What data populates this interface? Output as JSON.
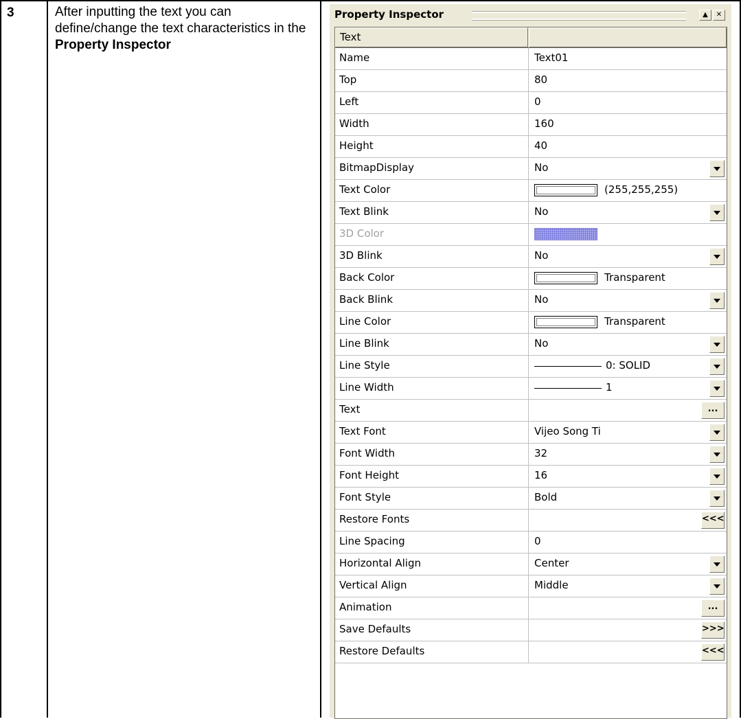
{
  "step": {
    "number": "3",
    "text_before": "After inputting the text you can define/change the text characteristics in the ",
    "text_bold": "Property Inspector"
  },
  "inspector": {
    "title": "Property Inspector",
    "title_buttons": [
      "▲",
      "✕"
    ],
    "header": {
      "name_col": "Text",
      "value_col": ""
    },
    "rows": [
      {
        "name": "Name",
        "value": "Text01",
        "kind": "text"
      },
      {
        "name": "Top",
        "value": "80",
        "kind": "text"
      },
      {
        "name": "Left",
        "value": "0",
        "kind": "text"
      },
      {
        "name": "Width",
        "value": "160",
        "kind": "text"
      },
      {
        "name": "Height",
        "value": "40",
        "kind": "text"
      },
      {
        "name": "BitmapDisplay",
        "value": "No",
        "kind": "dropdown"
      },
      {
        "name": "Text Color",
        "value": "(255,255,255)",
        "kind": "color",
        "swatch": "#ffffff"
      },
      {
        "name": "Text Blink",
        "value": "No",
        "kind": "dropdown"
      },
      {
        "name": "3D Color",
        "value": "",
        "kind": "color-pattern",
        "disabled": true
      },
      {
        "name": "3D Blink",
        "value": "No",
        "kind": "dropdown"
      },
      {
        "name": "Back Color",
        "value": "Transparent",
        "kind": "color",
        "swatch": "#ffffff"
      },
      {
        "name": "Back Blink",
        "value": "No",
        "kind": "dropdown"
      },
      {
        "name": "Line Color",
        "value": "Transparent",
        "kind": "color",
        "swatch": "#ffffff"
      },
      {
        "name": "Line Blink",
        "value": "No",
        "kind": "dropdown"
      },
      {
        "name": "Line Style",
        "value": "0: SOLID",
        "kind": "line-dropdown"
      },
      {
        "name": "Line Width",
        "value": "1",
        "kind": "line-dropdown"
      },
      {
        "name": "Text",
        "value": "",
        "kind": "button",
        "button_label": "..."
      },
      {
        "name": "Text Font",
        "value": "Vijeo Song Ti",
        "kind": "dropdown"
      },
      {
        "name": "Font Width",
        "value": "32",
        "kind": "dropdown"
      },
      {
        "name": "Font Height",
        "value": "16",
        "kind": "dropdown"
      },
      {
        "name": "Font Style",
        "value": "Bold",
        "kind": "dropdown"
      },
      {
        "name": "Restore Fonts",
        "value": "",
        "kind": "button",
        "button_label": "<<<"
      },
      {
        "name": "Line Spacing",
        "value": "0",
        "kind": "text"
      },
      {
        "name": "Horizontal Align",
        "value": "Center",
        "kind": "dropdown"
      },
      {
        "name": "Vertical Align",
        "value": "Middle",
        "kind": "dropdown"
      },
      {
        "name": "Animation",
        "value": "",
        "kind": "button",
        "button_label": "..."
      },
      {
        "name": "Save Defaults",
        "value": "",
        "kind": "button",
        "button_label": ">>>"
      },
      {
        "name": "Restore Defaults",
        "value": "",
        "kind": "button",
        "button_label": "<<<"
      }
    ]
  }
}
